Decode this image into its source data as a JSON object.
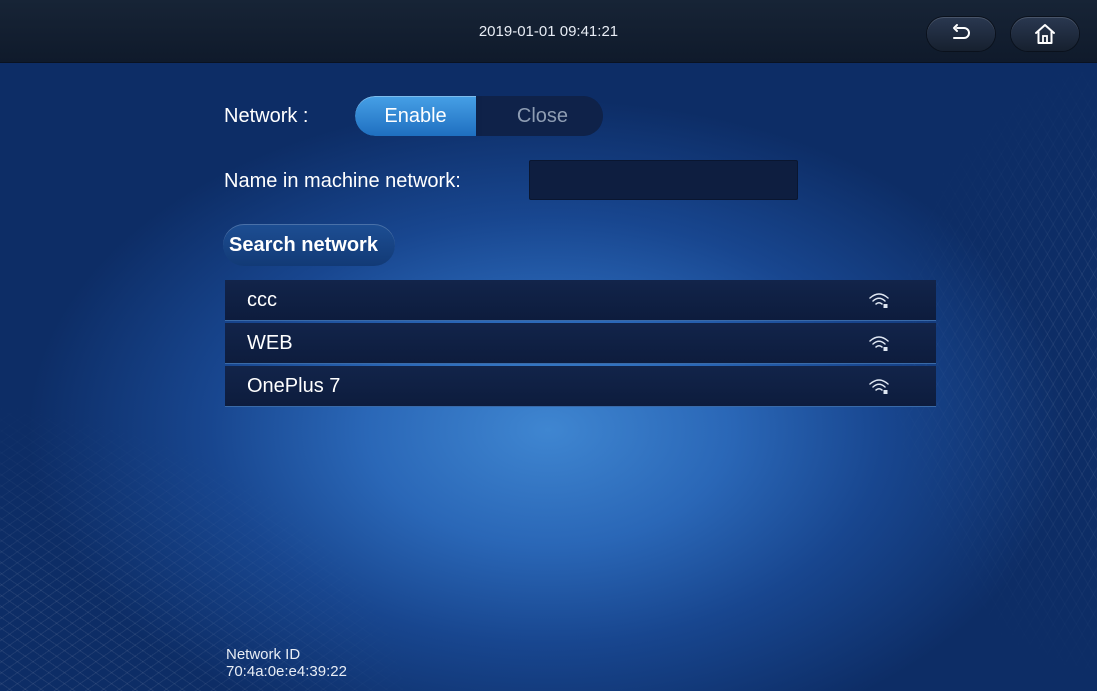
{
  "topbar": {
    "datetime": "2019-01-01 09:41:21",
    "back_icon": "back-arrow-icon",
    "home_icon": "home-icon"
  },
  "network": {
    "label": "Network :",
    "enable_label": "Enable",
    "close_label": "Close",
    "selected": "Enable"
  },
  "machine_name": {
    "label": "Name in machine network:",
    "value": ""
  },
  "search": {
    "label": "Search network"
  },
  "networks": [
    {
      "name": "ccc",
      "icon": "wifi-icon"
    },
    {
      "name": "WEB",
      "icon": "wifi-icon"
    },
    {
      "name": "OnePlus 7",
      "icon": "wifi-icon"
    }
  ],
  "footer": {
    "network_id": "Network ID  70:4a:0e:e4:39:22"
  },
  "colors": {
    "accent": "#2f86d6",
    "topbar": "#141f30",
    "row_bg": "#10224a"
  }
}
